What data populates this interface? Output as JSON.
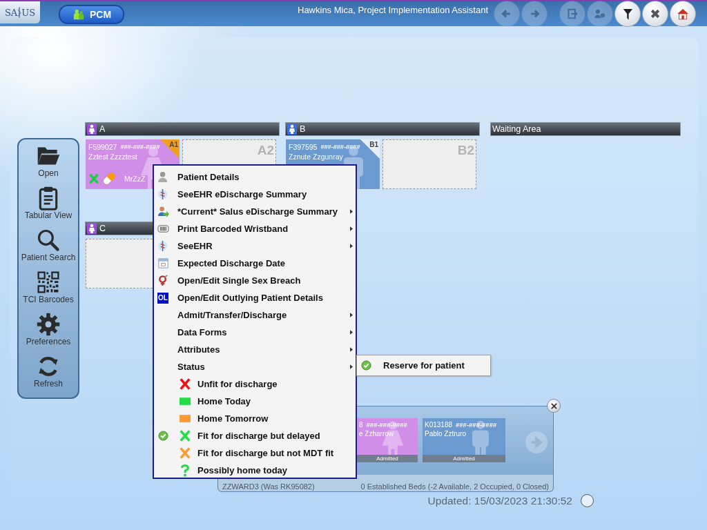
{
  "top_bar": {
    "logo": {
      "left": "SA",
      "right": "US"
    },
    "module_button": "PCM",
    "user": "Hawkins Mica, Project Implementation Assistant",
    "tools": [
      {
        "kind": "back",
        "disabled": true
      },
      {
        "kind": "forward",
        "disabled": true
      },
      {
        "kind": "logout",
        "disabled": true
      },
      {
        "kind": "switch-user",
        "disabled": true
      },
      {
        "kind": "filter",
        "disabled": false
      },
      {
        "kind": "close",
        "disabled": false
      },
      {
        "kind": "home",
        "disabled": false
      }
    ]
  },
  "sidebar": {
    "items": [
      {
        "kind": "open",
        "label": "Open"
      },
      {
        "kind": "tabular",
        "label": "Tabular View"
      },
      {
        "kind": "search",
        "label": "Patient Search"
      },
      {
        "kind": "barcode",
        "label": "TCI Barcodes"
      },
      {
        "kind": "preferences",
        "label": "Preferences"
      },
      {
        "kind": "refresh",
        "label": "Refresh"
      }
    ]
  },
  "bays": [
    {
      "name": "A",
      "color": "#9b4fe0",
      "beds": [
        {
          "kind": "female",
          "bed": "A1",
          "id": "F599027",
          "nhs": "###-###-####",
          "name": "Zztest Zzzztest",
          "color": "#d08ee8",
          "flagged": true,
          "status": {
            "color": "#22cc44"
          },
          "medication": true,
          "title": "MrZzZ"
        },
        {
          "kind": "empty",
          "bed": "A2"
        }
      ]
    },
    {
      "name": "B",
      "color": "#3a6ee0",
      "beds": [
        {
          "kind": "male",
          "bed": "B1",
          "id": "F397595",
          "nhs": "###-###-####",
          "name": "Zznute Zzgunray",
          "color": "#6a9ad0",
          "flagged": false
        },
        {
          "kind": "empty",
          "bed": "B2"
        }
      ]
    },
    {
      "name": "Waiting Area"
    },
    {
      "name": "C",
      "color": "#9b4fe0",
      "beds": [
        {
          "kind": "empty"
        }
      ]
    }
  ],
  "ward_popup": {
    "ward": "ZZWARD3 (Was RK95082)",
    "summary": "0 Established Beds (-2 Available, 2 Occupied, 0 Closed)",
    "patients": [
      {
        "kind": "female",
        "id": "8",
        "nhs": "###-###-####",
        "name": "e Zzharrow",
        "status": "Admitted",
        "color": "#d08ee8"
      },
      {
        "kind": "male",
        "id": "K013188",
        "nhs": "###-###-####",
        "name": "Pablo Zztruro",
        "status": "Admitted",
        "color": "#6a9ad0"
      }
    ]
  },
  "updated": "Updated: 15/03/2023 21:30:52",
  "context_menu": {
    "items": [
      {
        "kind": "person",
        "label": "Patient Details",
        "submenu": false
      },
      {
        "kind": "helix",
        "label": "SeeEHR eDischarge Summary",
        "submenu": false
      },
      {
        "kind": "person-arrow",
        "label": "*Current* Salus eDischarge Summary",
        "submenu": true
      },
      {
        "kind": "wristband",
        "label": "Print Barcoded Wristband",
        "submenu": true
      },
      {
        "kind": "helix",
        "label": "SeeEHR",
        "submenu": true
      },
      {
        "kind": "calendar",
        "label": "Expected Discharge Date",
        "submenu": false
      },
      {
        "kind": "gender",
        "label": "Open/Edit Single Sex Breach",
        "submenu": false
      },
      {
        "kind": "badge",
        "badge": "OL",
        "label": "Open/Edit Outlying Patient Details",
        "submenu": false
      },
      {
        "kind": "plain",
        "label": "Admit/Transfer/Discharge",
        "submenu": true
      },
      {
        "kind": "plain",
        "label": "Data Forms",
        "submenu": true
      },
      {
        "kind": "plain",
        "label": "Attributes",
        "submenu": true
      },
      {
        "kind": "plain",
        "label": "Status",
        "submenu": true
      },
      {
        "kind": "cross",
        "color": "#ee1111",
        "label": "Unfit for discharge",
        "selected": false
      },
      {
        "kind": "block",
        "color": "#22dd44",
        "label": "Home Today",
        "selected": false
      },
      {
        "kind": "block",
        "color": "#ff9933",
        "label": "Home Tomorrow",
        "selected": false
      },
      {
        "kind": "cross",
        "color": "#22dd44",
        "label": "Fit for discharge but delayed",
        "selected": true
      },
      {
        "kind": "cross",
        "color": "#ff9933",
        "label": "Fit for discharge but not MDT fit",
        "selected": false
      },
      {
        "kind": "question",
        "color": "#22dd44",
        "label": "Possibly home today",
        "selected": false
      }
    ]
  },
  "submenu": {
    "items": [
      {
        "label": "Reserve for patient"
      }
    ]
  }
}
